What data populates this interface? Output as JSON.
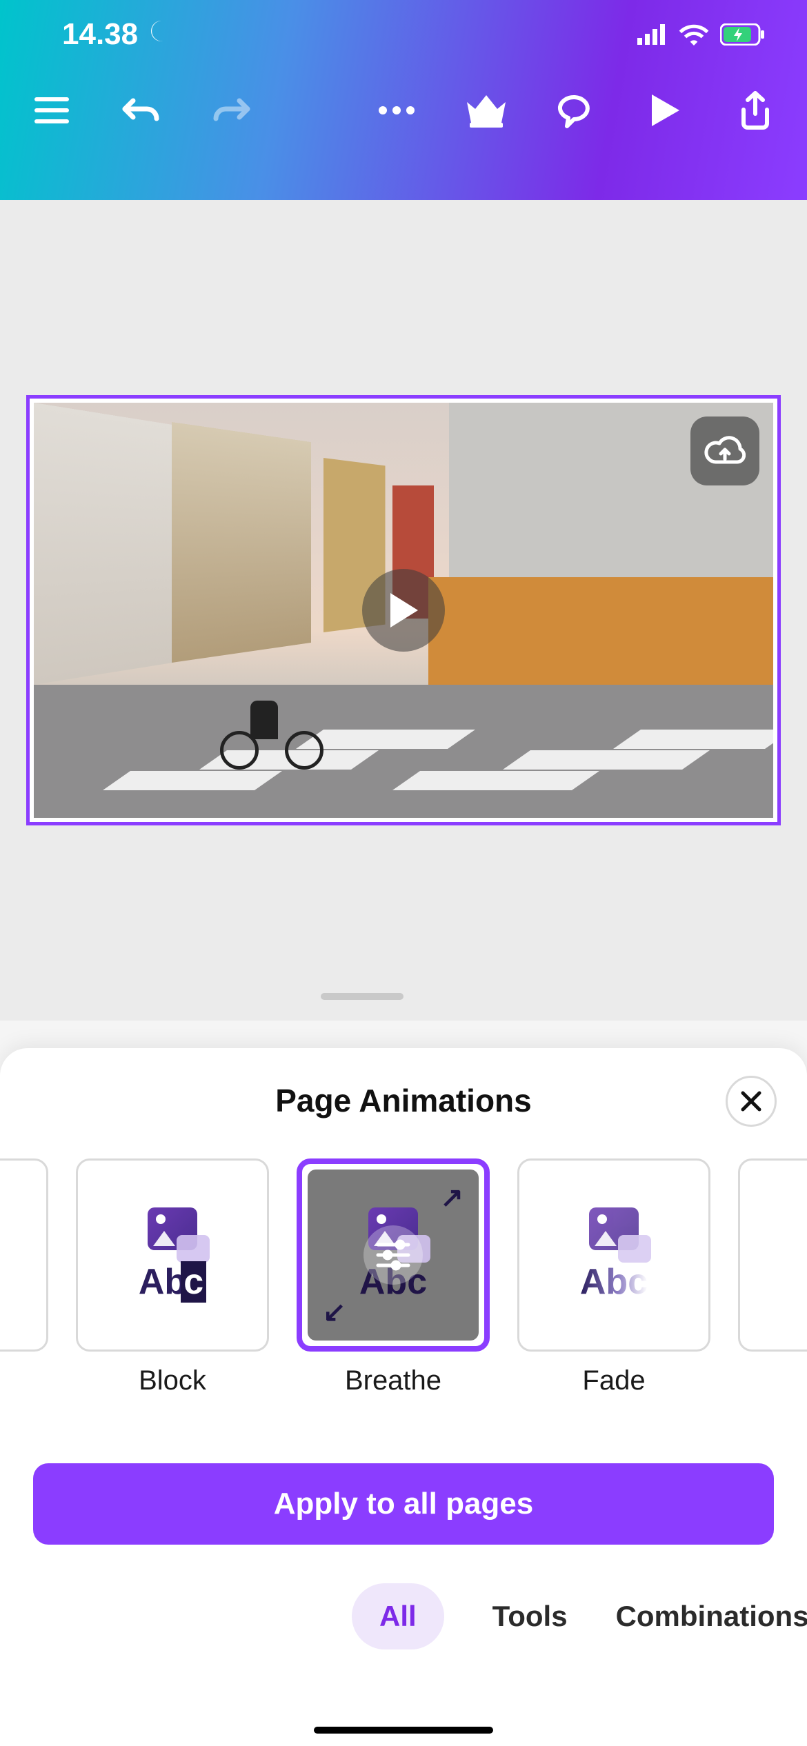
{
  "status": {
    "time": "14.38"
  },
  "sheet": {
    "title": "Page Animations",
    "apply_label": "Apply to all pages"
  },
  "animations": [
    {
      "label": ""
    },
    {
      "label": "Block"
    },
    {
      "label": "Breathe"
    },
    {
      "label": "Fade"
    },
    {
      "label": ""
    }
  ],
  "tabs": {
    "all": "All",
    "tools": "Tools",
    "combinations": "Combinations"
  }
}
